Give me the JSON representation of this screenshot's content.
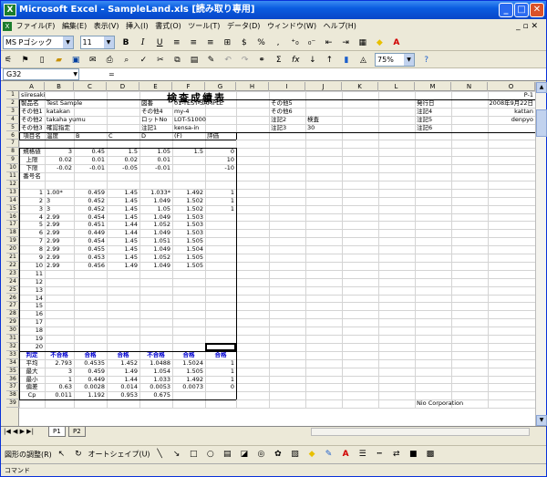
{
  "window": {
    "title": "Microsoft Excel - SampleLand.xls [読み取り専用]"
  },
  "menu": [
    "ファイル(F)",
    "編集(E)",
    "表示(V)",
    "挿入(I)",
    "書式(O)",
    "ツール(T)",
    "データ(D)",
    "ウィンドウ(W)",
    "ヘルプ(H)"
  ],
  "font": {
    "name": "MS Pゴシック",
    "size": "11"
  },
  "zoom": "75%",
  "namebox": "G32",
  "formula_fx": "=",
  "columns": [
    "A",
    "B",
    "C",
    "D",
    "E",
    "F",
    "G",
    "H",
    "I",
    "J",
    "K",
    "L",
    "M",
    "N",
    "O"
  ],
  "rows": [
    "1",
    "2",
    "3",
    "4",
    "5",
    "6",
    "7",
    "8",
    "9",
    "10",
    "11",
    "12",
    "13",
    "14",
    "15",
    "16",
    "17",
    "18",
    "19",
    "20",
    "21",
    "22",
    "23",
    "24",
    "25",
    "26",
    "27",
    "28",
    "29",
    "30",
    "31",
    "32",
    "33",
    "34",
    "35",
    "36",
    "37",
    "38",
    "39"
  ],
  "sheet": {
    "title": "検査成績表",
    "company": "siiresaki",
    "page": "P-1",
    "info_left": [
      {
        "label": "製品名",
        "value": "Test Sample"
      },
      {
        "label": "その他1",
        "value": "katakan"
      },
      {
        "label": "その他2",
        "value": "takaha yumu"
      },
      {
        "label": "その他3",
        "value": "確認指定"
      }
    ],
    "info_mid": [
      {
        "label": "図番",
        "value": "01-TEST-SAMPLE"
      },
      {
        "label": "その他4",
        "value": "my-4"
      },
      {
        "label": "ロットNo",
        "value": "LOT-S1000"
      },
      {
        "label": "注記1",
        "value": "kensa-in"
      }
    ],
    "info_right": [
      {
        "label": "その他5",
        "value": ""
      },
      {
        "label": "その他6",
        "value": ""
      },
      {
        "label": "注記2",
        "value": "検査"
      },
      {
        "label": "注記3",
        "value": "30"
      }
    ],
    "info_far": [
      {
        "label": "発行日",
        "value": "2008年9月22日"
      },
      {
        "label": "注記4",
        "value": "kattan"
      },
      {
        "label": "注記5",
        "value": "denpyo"
      },
      {
        "label": "注記6",
        "value": ""
      }
    ],
    "item_header": [
      "項目名",
      "温度",
      "B",
      "C",
      "D",
      "(F)",
      "評価"
    ],
    "spec_rows": [
      {
        "label": "規格値",
        "values": [
          "3",
          "0.45",
          "1.5",
          "1.05",
          "1.5",
          "0"
        ]
      },
      {
        "label": "上限",
        "values": [
          "0.02",
          "0.01",
          "0.02",
          "0.01",
          "",
          "10"
        ]
      },
      {
        "label": "下限",
        "values": [
          "-0.02",
          "-0.01",
          "-0.05",
          "-0.01",
          "",
          "-10"
        ]
      }
    ],
    "sample_label": "番号名",
    "data_rows": [
      [
        "1",
        "1.00*",
        "0.459",
        "1.45",
        "1.033*",
        "1.492",
        "1"
      ],
      [
        "2",
        "3",
        "0.452",
        "1.45",
        "1.049",
        "1.502",
        "1"
      ],
      [
        "3",
        "3",
        "0.452",
        "1.45",
        "1.05",
        "1.502",
        "1"
      ],
      [
        "4",
        "2.99",
        "0.454",
        "1.45",
        "1.049",
        "1.503",
        ""
      ],
      [
        "5",
        "2.99",
        "0.451",
        "1.44",
        "1.052",
        "1.503",
        ""
      ],
      [
        "6",
        "2.99",
        "0.449",
        "1.44",
        "1.049",
        "1.503",
        ""
      ],
      [
        "7",
        "2.99",
        "0.454",
        "1.45",
        "1.051",
        "1.505",
        ""
      ],
      [
        "8",
        "2.99",
        "0.455",
        "1.45",
        "1.049",
        "1.504",
        ""
      ],
      [
        "9",
        "2.99",
        "0.453",
        "1.45",
        "1.052",
        "1.505",
        ""
      ],
      [
        "10",
        "2.99",
        "0.456",
        "1.49",
        "1.049",
        "1.505",
        ""
      ]
    ],
    "empty_numbers": [
      "11",
      "12",
      "13",
      "14",
      "15",
      "16",
      "17",
      "18",
      "19",
      "20"
    ],
    "judge_header": [
      "判定",
      "不合格",
      "合格",
      "合格",
      "不合格",
      "合格",
      "合格"
    ],
    "stat_rows": [
      {
        "label": "平均",
        "values": [
          "2.793",
          "0.4535",
          "1.452",
          "1.0488",
          "1.5024",
          "1"
        ]
      },
      {
        "label": "最大",
        "values": [
          "3",
          "0.459",
          "1.49",
          "1.054",
          "1.505",
          "1"
        ]
      },
      {
        "label": "最小",
        "values": [
          "1",
          "0.449",
          "1.44",
          "1.033",
          "1.492",
          "1"
        ]
      },
      {
        "label": "偏差",
        "values": [
          "0.63",
          "0.0028",
          "0.014",
          "0.0053",
          "0.0073",
          "0"
        ]
      },
      {
        "label": "Cp",
        "values": [
          "0.011",
          "1.192",
          "0.953",
          "0.675",
          "",
          ""
        ]
      }
    ],
    "footer_company": "Nio Corporation"
  },
  "tabs": [
    "P1",
    "P2"
  ],
  "drawbar": {
    "draw_label": "図形の調整(R)",
    "autoshape_label": "オートシェイプ(U)"
  },
  "status": "コマンド"
}
